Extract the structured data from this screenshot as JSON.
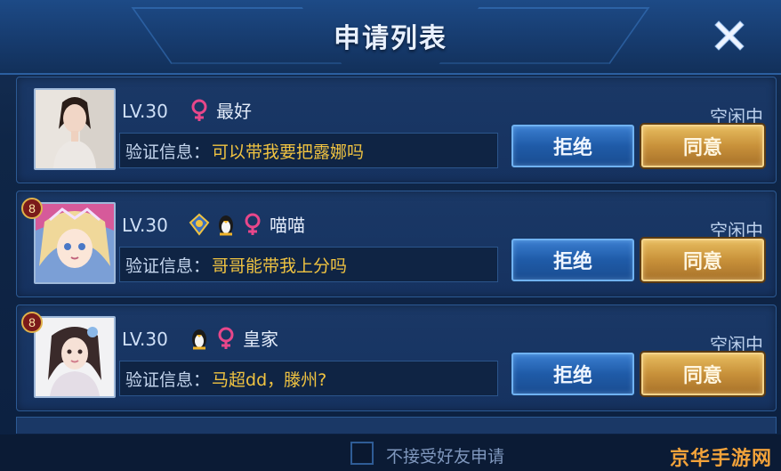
{
  "header": {
    "title": "申请列表"
  },
  "requests": [
    {
      "level": "LV.30",
      "nickname": "最好",
      "status": "空闲中",
      "verify_key": "验证信息：",
      "verify_msg": "可以带我要把露娜吗",
      "reject_label": "拒绝",
      "accept_label": "同意",
      "rank_badge": "",
      "icons": [
        "female-icon"
      ]
    },
    {
      "level": "LV.30",
      "nickname": "喵喵",
      "status": "空闲中",
      "verify_key": "验证信息：",
      "verify_msg": "哥哥能带我上分吗",
      "reject_label": "拒绝",
      "accept_label": "同意",
      "rank_badge": "8",
      "icons": [
        "rank-emblem-icon",
        "penguin-icon",
        "female-icon"
      ]
    },
    {
      "level": "LV.30",
      "nickname": "皇家",
      "status": "空闲中",
      "verify_key": "验证信息：",
      "verify_msg": "马超dd，滕州?",
      "reject_label": "拒绝",
      "accept_label": "同意",
      "rank_badge": "8",
      "icons": [
        "penguin-icon",
        "female-icon"
      ]
    }
  ],
  "footer": {
    "checkbox_label": "不接受好友申请",
    "checked": false
  },
  "watermark": "京华手游网",
  "colors": {
    "accent_gold": "#f0c341",
    "female_pink": "#e8478a",
    "reject_blue": "#1f5ba8",
    "accept_gold": "#c8913a"
  }
}
